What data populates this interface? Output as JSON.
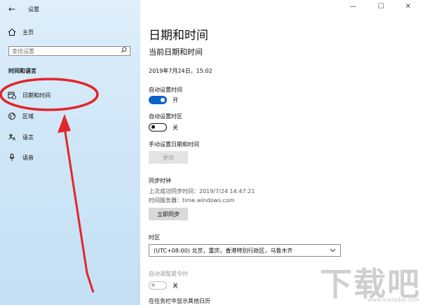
{
  "window": {
    "title": "设置"
  },
  "nav": {
    "home": "主页",
    "search_placeholder": "查找设置",
    "section": "时间和语言",
    "items": [
      {
        "label": "日期和时间",
        "icon": "calendar-clock-icon"
      },
      {
        "label": "区域",
        "icon": "globe-icon"
      },
      {
        "label": "语言",
        "icon": "language-icon"
      },
      {
        "label": "语音",
        "icon": "microphone-icon"
      }
    ]
  },
  "main": {
    "title": "日期和时间",
    "current_heading": "当前日期和时间",
    "current_value": "2019年7月24日，15:02",
    "auto_time_label": "自动设置时间",
    "auto_time_state": "开",
    "auto_zone_label": "自动设置时区",
    "auto_zone_state": "关",
    "manual_label": "手动设置日期和时间",
    "change_button": "更改",
    "sync_heading": "同步时钟",
    "last_sync": "上次成功同步时间：2019/7/24 14:47:21",
    "time_server": "时间服务器：time.windows.com",
    "sync_button": "立即同步",
    "timezone_heading": "时区",
    "timezone_value": "(UTC+08:00) 北京，重庆，香港特别行政区，乌鲁木齐",
    "dst_label": "自动调整夏令时",
    "dst_state": "关",
    "taskbar_label": "在任务栏中显示其他日历"
  },
  "watermark": {
    "main": "下载吧",
    "sub": "www.xiazaiba.com"
  },
  "colors": {
    "accent": "#0a63c8",
    "annotation": "#e0262a"
  }
}
